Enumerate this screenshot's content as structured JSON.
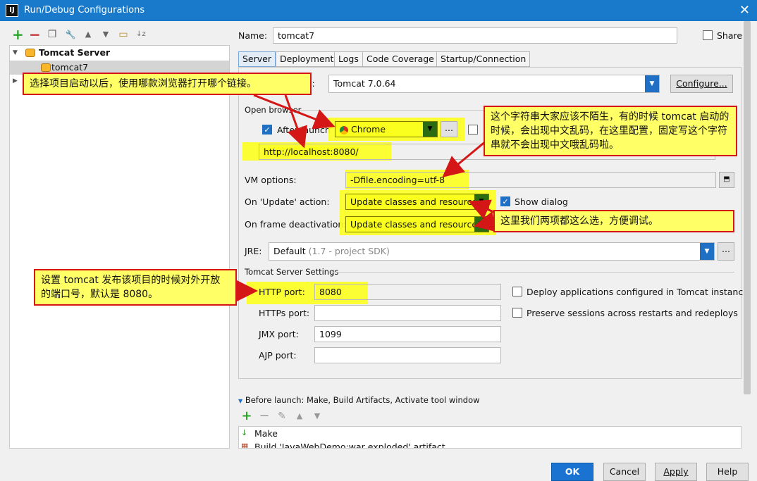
{
  "window": {
    "title": "Run/Debug Configurations",
    "icon_text": "IJ",
    "close_glyph": "✕"
  },
  "toolbar": {
    "icons": [
      "add-icon",
      "remove-icon",
      "copy-icon",
      "wrench-icon",
      "move-up-icon",
      "move-down-icon",
      "folder-icon",
      "sort-icon"
    ],
    "add_glyph": "+",
    "remove_glyph": "−",
    "copy_glyph": "❐",
    "wrench_glyph": "🔧",
    "up_glyph": "▲",
    "down_glyph": "▼",
    "folder_glyph": "▭",
    "sort_glyph": "↓z"
  },
  "tree": {
    "group_label": "Tomcat Server",
    "item_label": "tomcat7"
  },
  "form": {
    "name_label": "Name:",
    "name_value": "tomcat7",
    "share_label": "Share",
    "tabs": [
      "Server",
      "Deployment",
      "Logs",
      "Code Coverage",
      "Startup/Connection"
    ],
    "app_server_label": "s:",
    "app_server_value": "Tomcat 7.0.64",
    "configure_label": "Configure...",
    "open_browser_label": "Open browser",
    "after_launch_label": "After launch",
    "browser_value": "Chrome",
    "browser_more": "...",
    "url_value": "http://localhost:8080/",
    "vm_options_label": "VM options:",
    "vm_options_value": "-Dfile.encoding=utf-8",
    "on_update_label": "On 'Update' action:",
    "on_update_value": "Update classes and resources",
    "show_dialog_label": "Show dialog",
    "on_frame_label": "On frame deactivation:",
    "on_frame_value": "Update classes and resources",
    "jre_label": "JRE:",
    "jre_value": "Default",
    "jre_hint": "(1.7 - project SDK)",
    "tomcat_settings_label": "Tomcat Server Settings",
    "http_port_label": "HTTP port:",
    "http_port_value": "8080",
    "https_port_label": "HTTPs port:",
    "https_port_value": "",
    "jmx_port_label": "JMX port:",
    "jmx_port_value": "1099",
    "ajp_port_label": "AJP port:",
    "ajp_port_value": "",
    "deploy_apps_label": "Deploy applications configured in Tomcat instance",
    "preserve_sessions_label": "Preserve sessions across restarts and redeploys"
  },
  "before_launch": {
    "header": "Before launch: Make, Build Artifacts, Activate tool window",
    "items": [
      "Make",
      "Build 'JavaWebDemo:war exploded' artifact"
    ]
  },
  "buttons": {
    "ok": "OK",
    "cancel": "Cancel",
    "apply": "Apply",
    "help": "Help"
  },
  "annotations": {
    "browser_note": "选择项目启动以后，使用哪款浏览器打开哪个链接。",
    "encoding_note": "这个字符串大家应该不陌生，有的时候 tomcat 启动的时候，会出现中文乱码，在这里配置，固定写这个字符串就不会出现中文哦乱码啦。",
    "update_note": "这里我们两项都这么选，方便调试。",
    "port_note": "设置 tomcat 发布该项目的时候对外开放的端口号，默认是 8080。"
  },
  "colors": {
    "titlebar": "#1979ca",
    "accent": "#1f6fc5",
    "highlight": "#fbff1e",
    "note_border": "#d41616",
    "ok_button": "#1a73d0"
  }
}
